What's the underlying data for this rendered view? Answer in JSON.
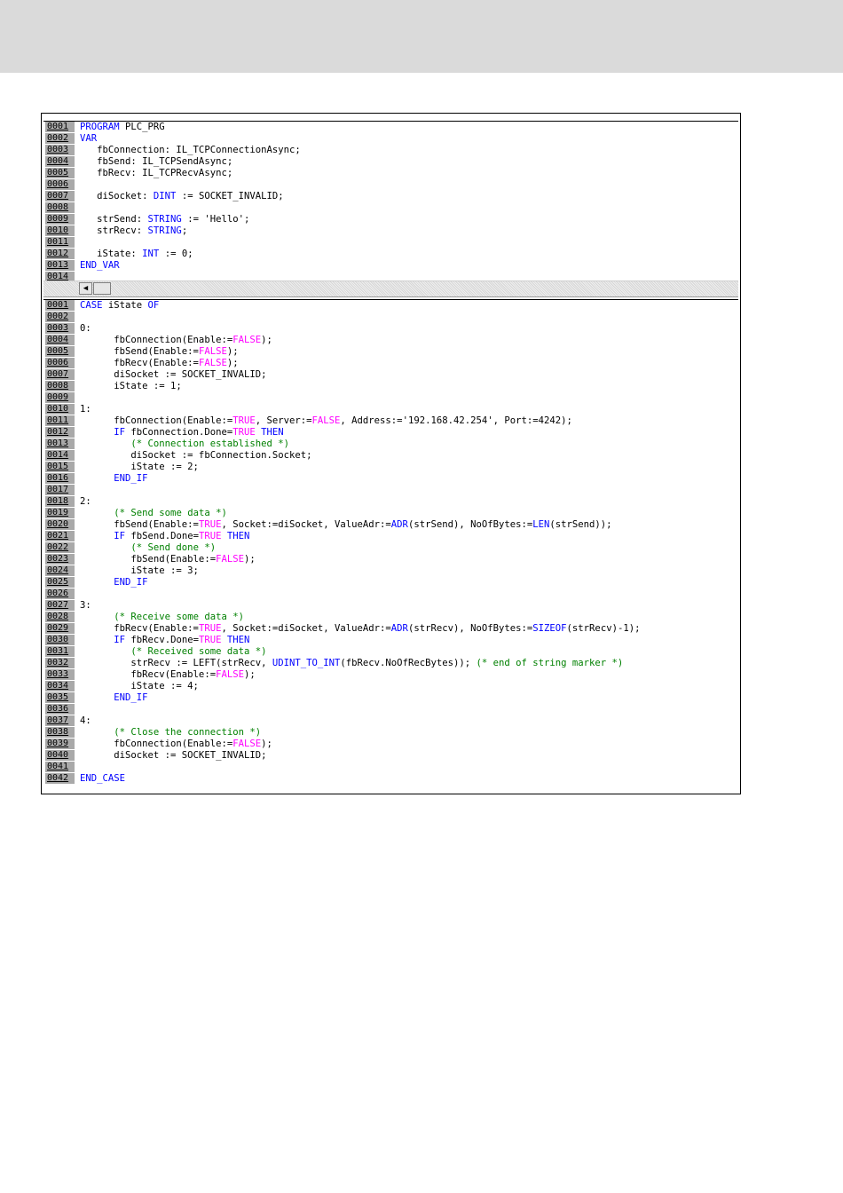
{
  "colors": {
    "keyword": "#0000ff",
    "literal": "#ff00ff",
    "comment": "#008000",
    "line_number_bg": "#a9a9a9",
    "top_band": "#dadada"
  },
  "icons": {
    "scroll_left": "left-arrow-icon"
  },
  "scroll_left_glyph": "◀",
  "declaration_lines": [
    {
      "ln": "0001",
      "segs": [
        {
          "t": "PROGRAM",
          "c": "kw"
        },
        {
          "t": " PLC_PRG"
        }
      ]
    },
    {
      "ln": "0002",
      "segs": [
        {
          "t": "VAR",
          "c": "kw"
        }
      ]
    },
    {
      "ln": "0003",
      "segs": [
        {
          "t": "   fbConnection: IL_TCPConnectionAsync;"
        }
      ]
    },
    {
      "ln": "0004",
      "segs": [
        {
          "t": "   fbSend: IL_TCPSendAsync;"
        }
      ]
    },
    {
      "ln": "0005",
      "segs": [
        {
          "t": "   fbRecv: IL_TCPRecvAsync;"
        }
      ]
    },
    {
      "ln": "0006",
      "segs": []
    },
    {
      "ln": "0007",
      "segs": [
        {
          "t": "   diSocket: "
        },
        {
          "t": "DINT",
          "c": "kw"
        },
        {
          "t": " := SOCKET_INVALID;"
        }
      ]
    },
    {
      "ln": "0008",
      "segs": []
    },
    {
      "ln": "0009",
      "segs": [
        {
          "t": "   strSend: "
        },
        {
          "t": "STRING",
          "c": "kw"
        },
        {
          "t": " := 'Hello';"
        }
      ]
    },
    {
      "ln": "0010",
      "segs": [
        {
          "t": "   strRecv: "
        },
        {
          "t": "STRING",
          "c": "kw"
        },
        {
          "t": ";"
        }
      ]
    },
    {
      "ln": "0011",
      "segs": []
    },
    {
      "ln": "0012",
      "segs": [
        {
          "t": "   iState: "
        },
        {
          "t": "INT",
          "c": "kw"
        },
        {
          "t": " := 0;"
        }
      ]
    },
    {
      "ln": "0013",
      "segs": [
        {
          "t": "END_VAR",
          "c": "kw"
        }
      ]
    },
    {
      "ln": "0014",
      "segs": []
    }
  ],
  "body_lines": [
    {
      "ln": "0001",
      "segs": [
        {
          "t": "CASE",
          "c": "kw"
        },
        {
          "t": " iState "
        },
        {
          "t": "OF",
          "c": "kw"
        }
      ]
    },
    {
      "ln": "0002",
      "segs": []
    },
    {
      "ln": "0003",
      "segs": [
        {
          "t": "0:"
        }
      ]
    },
    {
      "ln": "0004",
      "segs": [
        {
          "t": "      fbConnection(Enable:="
        },
        {
          "t": "FALSE",
          "c": "lit"
        },
        {
          "t": ");"
        }
      ]
    },
    {
      "ln": "0005",
      "segs": [
        {
          "t": "      fbSend(Enable:="
        },
        {
          "t": "FALSE",
          "c": "lit"
        },
        {
          "t": ");"
        }
      ]
    },
    {
      "ln": "0006",
      "segs": [
        {
          "t": "      fbRecv(Enable:="
        },
        {
          "t": "FALSE",
          "c": "lit"
        },
        {
          "t": ");"
        }
      ]
    },
    {
      "ln": "0007",
      "segs": [
        {
          "t": "      diSocket := SOCKET_INVALID;"
        }
      ]
    },
    {
      "ln": "0008",
      "segs": [
        {
          "t": "      iState := 1;"
        }
      ]
    },
    {
      "ln": "0009",
      "segs": []
    },
    {
      "ln": "0010",
      "segs": [
        {
          "t": "1:"
        }
      ]
    },
    {
      "ln": "0011",
      "segs": [
        {
          "t": "      fbConnection(Enable:="
        },
        {
          "t": "TRUE",
          "c": "lit"
        },
        {
          "t": ", Server:="
        },
        {
          "t": "FALSE",
          "c": "lit"
        },
        {
          "t": ", Address:='192.168.42.254', Port:=4242);"
        }
      ]
    },
    {
      "ln": "0012",
      "segs": [
        {
          "t": "      "
        },
        {
          "t": "IF",
          "c": "kw"
        },
        {
          "t": " fbConnection.Done="
        },
        {
          "t": "TRUE",
          "c": "lit"
        },
        {
          "t": " "
        },
        {
          "t": "THEN",
          "c": "kw"
        }
      ]
    },
    {
      "ln": "0013",
      "segs": [
        {
          "t": "         "
        },
        {
          "t": "(* Connection established *)",
          "c": "cmt"
        }
      ]
    },
    {
      "ln": "0014",
      "segs": [
        {
          "t": "         diSocket := fbConnection.Socket;"
        }
      ]
    },
    {
      "ln": "0015",
      "segs": [
        {
          "t": "         iState := 2;"
        }
      ]
    },
    {
      "ln": "0016",
      "segs": [
        {
          "t": "      "
        },
        {
          "t": "END_IF",
          "c": "kw"
        }
      ]
    },
    {
      "ln": "0017",
      "segs": []
    },
    {
      "ln": "0018",
      "segs": [
        {
          "t": "2:"
        }
      ]
    },
    {
      "ln": "0019",
      "segs": [
        {
          "t": "      "
        },
        {
          "t": "(* Send some data *)",
          "c": "cmt"
        }
      ]
    },
    {
      "ln": "0020",
      "segs": [
        {
          "t": "      fbSend(Enable:="
        },
        {
          "t": "TRUE",
          "c": "lit"
        },
        {
          "t": ", Socket:=diSocket, ValueAdr:="
        },
        {
          "t": "ADR",
          "c": "kw"
        },
        {
          "t": "(strSend), NoOfBytes:="
        },
        {
          "t": "LEN",
          "c": "kw"
        },
        {
          "t": "(strSend));"
        }
      ]
    },
    {
      "ln": "0021",
      "segs": [
        {
          "t": "      "
        },
        {
          "t": "IF",
          "c": "kw"
        },
        {
          "t": " fbSend.Done="
        },
        {
          "t": "TRUE",
          "c": "lit"
        },
        {
          "t": " "
        },
        {
          "t": "THEN",
          "c": "kw"
        }
      ]
    },
    {
      "ln": "0022",
      "segs": [
        {
          "t": "         "
        },
        {
          "t": "(* Send done *)",
          "c": "cmt"
        }
      ]
    },
    {
      "ln": "0023",
      "segs": [
        {
          "t": "         fbSend(Enable:="
        },
        {
          "t": "FALSE",
          "c": "lit"
        },
        {
          "t": ");"
        }
      ]
    },
    {
      "ln": "0024",
      "segs": [
        {
          "t": "         iState := 3;"
        }
      ]
    },
    {
      "ln": "0025",
      "segs": [
        {
          "t": "      "
        },
        {
          "t": "END_IF",
          "c": "kw"
        }
      ]
    },
    {
      "ln": "0026",
      "segs": []
    },
    {
      "ln": "0027",
      "segs": [
        {
          "t": "3:"
        }
      ]
    },
    {
      "ln": "0028",
      "segs": [
        {
          "t": "      "
        },
        {
          "t": "(* Receive some data *)",
          "c": "cmt"
        }
      ]
    },
    {
      "ln": "0029",
      "segs": [
        {
          "t": "      fbRecv(Enable:="
        },
        {
          "t": "TRUE",
          "c": "lit"
        },
        {
          "t": ", Socket:=diSocket, ValueAdr:="
        },
        {
          "t": "ADR",
          "c": "kw"
        },
        {
          "t": "(strRecv), NoOfBytes:="
        },
        {
          "t": "SIZEOF",
          "c": "kw"
        },
        {
          "t": "(strRecv)-1);"
        }
      ]
    },
    {
      "ln": "0030",
      "segs": [
        {
          "t": "      "
        },
        {
          "t": "IF",
          "c": "kw"
        },
        {
          "t": " fbRecv.Done="
        },
        {
          "t": "TRUE",
          "c": "lit"
        },
        {
          "t": " "
        },
        {
          "t": "THEN",
          "c": "kw"
        }
      ]
    },
    {
      "ln": "0031",
      "segs": [
        {
          "t": "         "
        },
        {
          "t": "(* Received some data *)",
          "c": "cmt"
        }
      ]
    },
    {
      "ln": "0032",
      "segs": [
        {
          "t": "         strRecv := LEFT(strRecv, "
        },
        {
          "t": "UDINT_TO_INT",
          "c": "kw"
        },
        {
          "t": "(fbRecv.NoOfRecBytes)); "
        },
        {
          "t": "(* end of string marker *)",
          "c": "cmt"
        }
      ]
    },
    {
      "ln": "0033",
      "segs": [
        {
          "t": "         fbRecv(Enable:="
        },
        {
          "t": "FALSE",
          "c": "lit"
        },
        {
          "t": ");"
        }
      ]
    },
    {
      "ln": "0034",
      "segs": [
        {
          "t": "         iState := 4;"
        }
      ]
    },
    {
      "ln": "0035",
      "segs": [
        {
          "t": "      "
        },
        {
          "t": "END_IF",
          "c": "kw"
        }
      ]
    },
    {
      "ln": "0036",
      "segs": []
    },
    {
      "ln": "0037",
      "segs": [
        {
          "t": "4:"
        }
      ]
    },
    {
      "ln": "0038",
      "segs": [
        {
          "t": "      "
        },
        {
          "t": "(* Close the connection *)",
          "c": "cmt"
        }
      ]
    },
    {
      "ln": "0039",
      "segs": [
        {
          "t": "      fbConnection(Enable:="
        },
        {
          "t": "FALSE",
          "c": "lit"
        },
        {
          "t": ");"
        }
      ]
    },
    {
      "ln": "0040",
      "segs": [
        {
          "t": "      diSocket := SOCKET_INVALID;"
        }
      ]
    },
    {
      "ln": "0041",
      "segs": []
    },
    {
      "ln": "0042",
      "segs": [
        {
          "t": "END_CASE",
          "c": "kw"
        }
      ]
    }
  ]
}
